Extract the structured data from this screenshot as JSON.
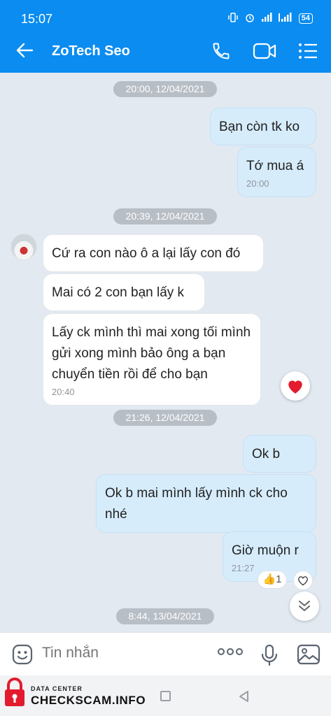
{
  "status_bar": {
    "time": "15:07",
    "battery": "54"
  },
  "header": {
    "title": "ZoTech Seo"
  },
  "timestamps": [
    "20:00, 12/04/2021",
    "20:39, 12/04/2021",
    "21:26, 12/04/2021",
    "8:44, 13/04/2021"
  ],
  "messages": [
    {
      "text": "Bạn còn tk ko"
    },
    {
      "text": "Tớ mua á",
      "time": "20:00"
    },
    {
      "text": "Cứ ra con nào ô a lại lấy con đó"
    },
    {
      "text": "Mai có 2 con bạn lấy k"
    },
    {
      "text": "Lấy ck mình thì mai xong tối mình gửi xong mình bảo ông a bạn chuyển tiền rồi để cho bạn",
      "time": "20:40"
    },
    {
      "text": "Ok b"
    },
    {
      "text": "Ok b mai mình lấy mình ck cho nhé"
    },
    {
      "text": "Giờ muộn r",
      "time": "21:27"
    }
  ],
  "reactions": {
    "like_count": "1"
  },
  "input": {
    "placeholder": "Tin nhắn"
  },
  "watermark": {
    "line1": "DATA CENTER",
    "line2": "CHECKSCAM.INFO"
  },
  "colors": {
    "header": "#0a8cf1",
    "mine_bubble": "#d6ecfb",
    "theirs_bubble": "#ffffff",
    "background": "#e2e9f1"
  }
}
